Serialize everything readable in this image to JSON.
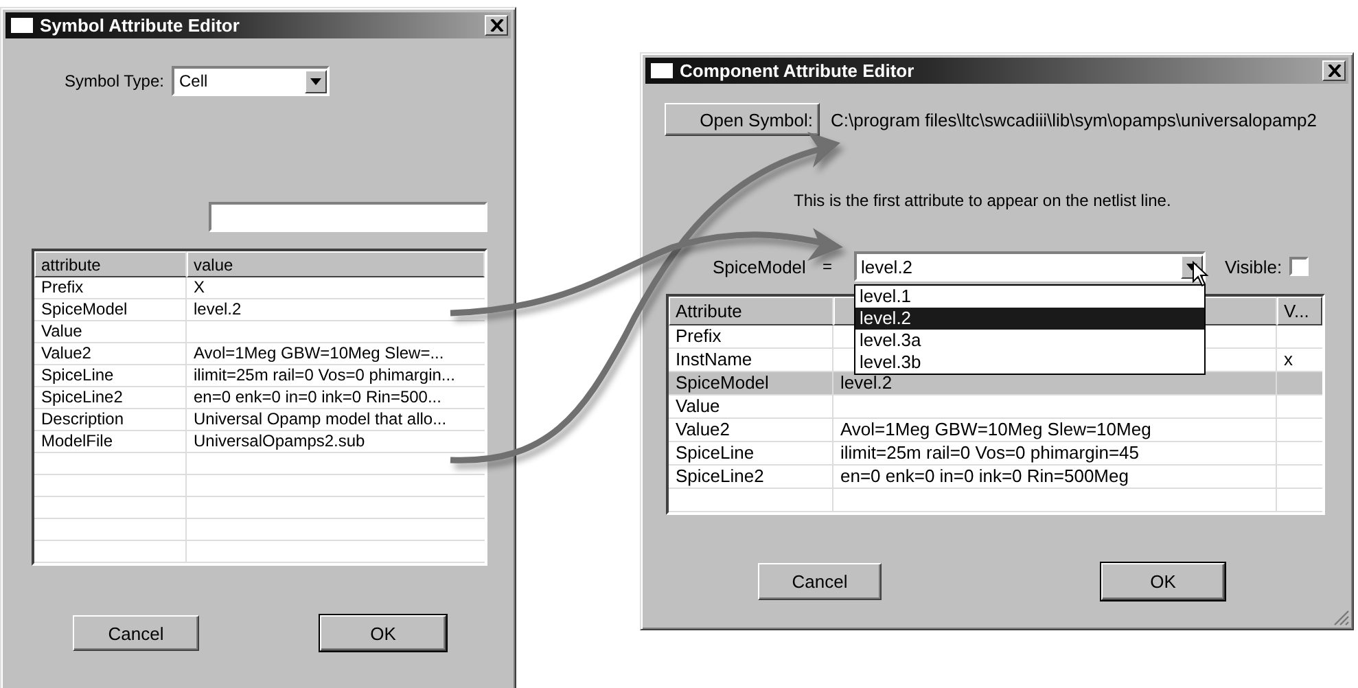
{
  "symbol_editor": {
    "title": "Symbol Attribute Editor",
    "symbol_type": {
      "label": "Symbol Type:",
      "value": "Cell"
    },
    "table": {
      "columns": [
        "attribute",
        "value"
      ],
      "rows": [
        {
          "attribute": "Prefix",
          "value": "X"
        },
        {
          "attribute": "SpiceModel",
          "value": "level.2"
        },
        {
          "attribute": "Value",
          "value": ""
        },
        {
          "attribute": "Value2",
          "value": "Avol=1Meg GBW=10Meg Slew=..."
        },
        {
          "attribute": "SpiceLine",
          "value": "ilimit=25m rail=0 Vos=0 phimargin..."
        },
        {
          "attribute": "SpiceLine2",
          "value": "en=0 enk=0 in=0 ink=0 Rin=500..."
        },
        {
          "attribute": "Description",
          "value": "Universal Opamp model that allo..."
        },
        {
          "attribute": "ModelFile",
          "value": "UniversalOpamps2.sub"
        }
      ]
    },
    "buttons": [
      "Cancel",
      "OK"
    ]
  },
  "component_editor": {
    "title": "Component Attribute Editor",
    "open_symbol_button": "Open Symbol:",
    "path": "C:\\program files\\ltc\\swcadiii\\lib\\sym\\opamps\\universalopamp2",
    "description": "This is the first attribute to appear on the netlist line.",
    "field": {
      "label": "SpiceModel",
      "equals": "=",
      "value": "level.2",
      "options": [
        {
          "label": "level.1",
          "selected": false
        },
        {
          "label": "level.2",
          "selected": true
        },
        {
          "label": "level.3a",
          "selected": false
        },
        {
          "label": "level.3b",
          "selected": false
        }
      ]
    },
    "visible": {
      "label": "Visible:",
      "checked": false
    },
    "table": {
      "column_1": "Attribute",
      "column_3": "V...",
      "rows": [
        {
          "attribute": "Prefix",
          "value": "",
          "visible": "",
          "selected": false
        },
        {
          "attribute": "InstName",
          "value": "",
          "visible": "x",
          "selected": false
        },
        {
          "attribute": "SpiceModel",
          "value": "level.2",
          "visible": "",
          "selected": true
        },
        {
          "attribute": "Value",
          "value": "",
          "visible": "",
          "selected": false
        },
        {
          "attribute": "Value2",
          "value": "Avol=1Meg GBW=10Meg Slew=10Meg",
          "visible": "",
          "selected": false
        },
        {
          "attribute": "SpiceLine",
          "value": "ilimit=25m rail=0 Vos=0 phimargin=45",
          "visible": "",
          "selected": false
        },
        {
          "attribute": "SpiceLine2",
          "value": "en=0 enk=0 in=0 ink=0 Rin=500Meg",
          "visible": "",
          "selected": false
        }
      ]
    },
    "buttons": [
      "Cancel",
      "OK"
    ]
  }
}
